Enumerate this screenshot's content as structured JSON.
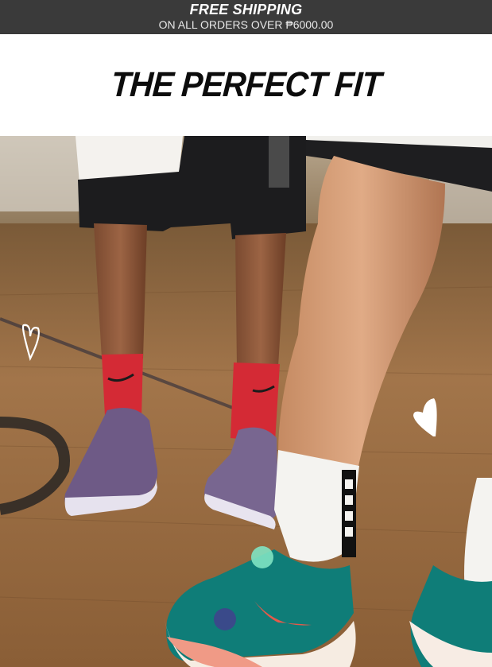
{
  "promo_bar": {
    "headline": "FREE SHIPPING",
    "subline": "ON ALL ORDERS OVER ₱6000.00"
  },
  "hero": {
    "title": "THE PERFECT FIT",
    "image_alt": "Players in Nike socks and basketball shoes standing on a hardwood court",
    "decorations": [
      "heart-doodle-icon",
      "heart-doodle-icon"
    ]
  }
}
